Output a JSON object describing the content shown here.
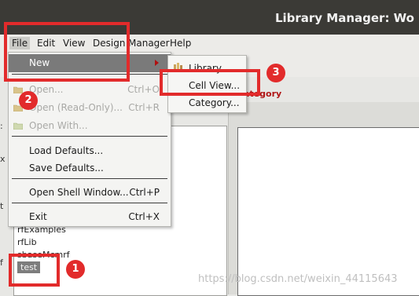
{
  "window": {
    "title": "Library Manager: Wo"
  },
  "menubar": {
    "file": "File",
    "edit": "Edit",
    "view": "View",
    "design": "Design",
    "manager": "Manager",
    "help": "Help"
  },
  "file_menu": {
    "new": "New",
    "open": "Open...",
    "open_shortcut": "Ctrl+O",
    "open_readonly": "Open (Read-Only)...",
    "open_readonly_shortcut": "Ctrl+R",
    "open_with": "Open With...",
    "load_defaults": "Load Defaults...",
    "save_defaults": "Save Defaults...",
    "open_shell": "Open Shell Window...",
    "open_shell_shortcut": "Ctrl+P",
    "exit": "Exit",
    "exit_shortcut": "Ctrl+X"
  },
  "new_submenu": {
    "library": "Library...",
    "cell_view": "Cell View...",
    "category": "Category..."
  },
  "category_header": "ategory",
  "libraries": [
    "rfExamples",
    "rfLib",
    "sbaseMcmrf",
    "test"
  ],
  "annotations": {
    "badge1": "1",
    "badge2": "2",
    "badge3": "3"
  },
  "watermark": "https://blog.csdn.net/weixin_44115643"
}
